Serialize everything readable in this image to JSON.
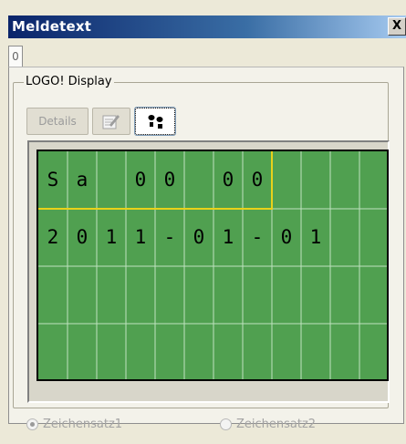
{
  "window": {
    "title": "Meldetext",
    "close_label": "X"
  },
  "tabs": [
    {
      "label": "0"
    }
  ],
  "group": {
    "label": "LOGO! Display"
  },
  "toolbar": {
    "details_label": "Details",
    "edit_icon": "edit-icon",
    "footprint_icon": "footprint-icon"
  },
  "display": {
    "rows": [
      [
        "S",
        "a",
        "",
        "0",
        "0",
        "",
        "0",
        "0",
        "",
        "",
        "",
        ""
      ],
      [
        "2",
        "0",
        "1",
        "1",
        "-",
        "0",
        "1",
        "-",
        "0",
        "1",
        "",
        ""
      ],
      [
        "",
        "",
        "",
        "",
        "",
        "",
        "",
        "",
        "",
        "",
        "",
        ""
      ],
      [
        "",
        "",
        "",
        "",
        "",
        "",
        "",
        "",
        "",
        "",
        "",
        ""
      ]
    ],
    "lcd_color": "#50a050",
    "grid_color": "#bfe2bf",
    "highlight_color": "#e8d21b"
  },
  "options": [
    {
      "label": "Zeichensatz1",
      "checked": true
    },
    {
      "label": "Zeichensatz2",
      "checked": false
    }
  ]
}
